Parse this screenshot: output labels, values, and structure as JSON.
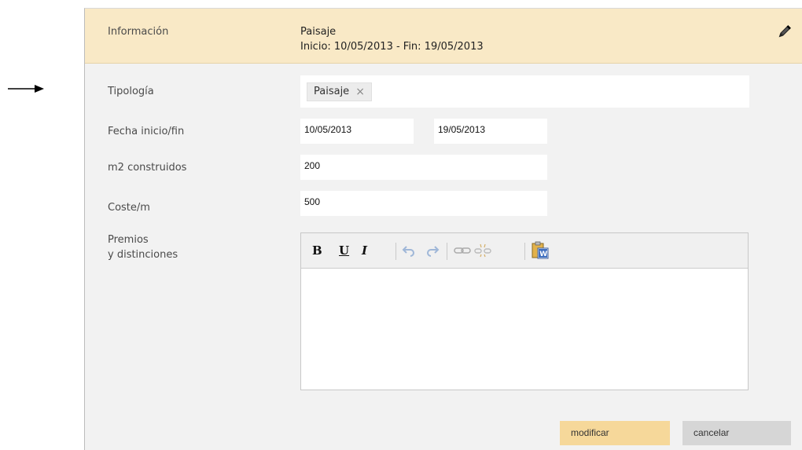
{
  "header": {
    "label": "Información",
    "title": "Paisaje",
    "subtitle": "Inicio: 10/05/2013 - Fin: 19/05/2013",
    "edit_icon": "pencil-icon"
  },
  "form": {
    "tipologia": {
      "label": "Tipología",
      "tags": [
        {
          "text": "Paisaje",
          "remove": "×"
        }
      ]
    },
    "fechas": {
      "label": "Fecha inicio/fin",
      "inicio": "10/05/2013",
      "fin": "19/05/2013"
    },
    "m2": {
      "label": "m2 construidos",
      "value": "200"
    },
    "coste": {
      "label": "Coste/m",
      "value": "500"
    },
    "premios": {
      "label_line1": "Premios",
      "label_line2": "y distinciones",
      "content": ""
    }
  },
  "editor_toolbar": {
    "bold": "B",
    "underline": "U",
    "italic": "I",
    "icons": [
      "undo-icon",
      "redo-icon",
      "link-icon",
      "unlink-icon",
      "paste-from-word-icon"
    ]
  },
  "actions": {
    "modify_label": "modificar",
    "cancel_label": "cancelar"
  },
  "colors": {
    "header_bg": "#f9e9c6",
    "panel_bg": "#f2f2f2",
    "modify_bg": "#f6d89a",
    "cancel_bg": "#d6d6d6"
  }
}
